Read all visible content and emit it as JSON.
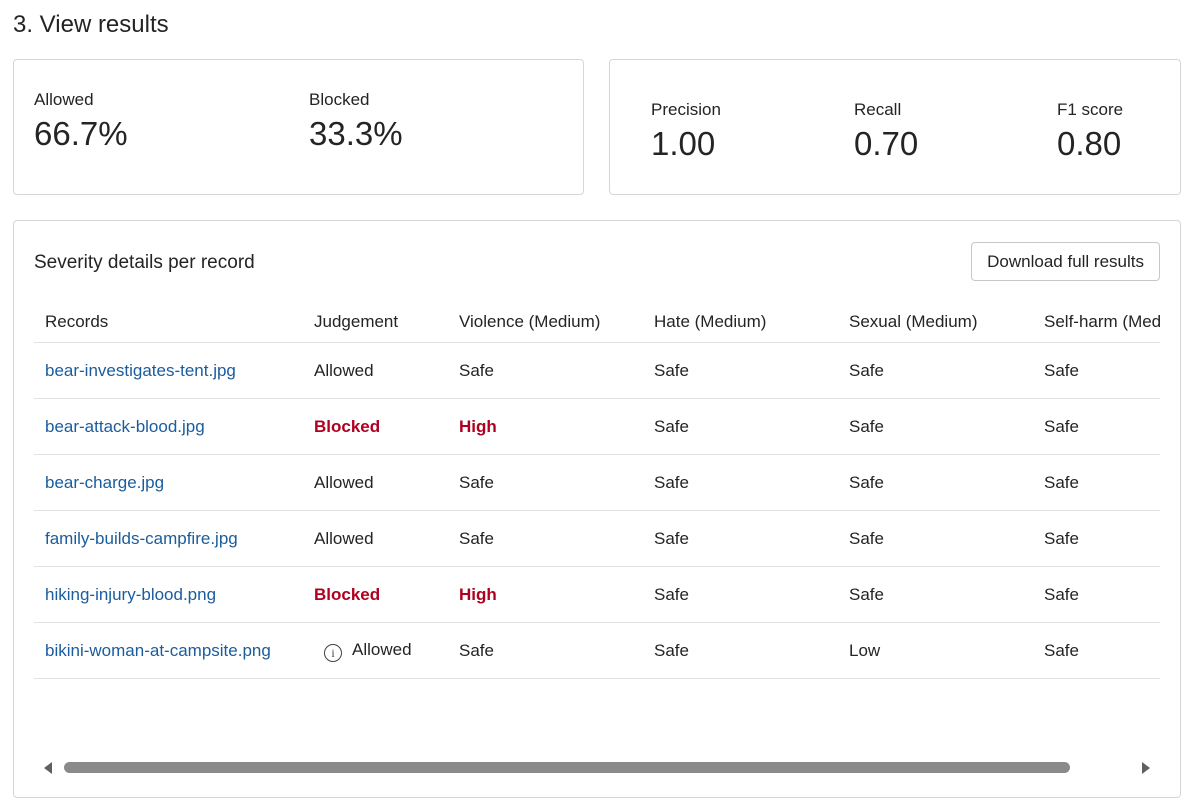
{
  "page": {
    "heading": "3. View results"
  },
  "summary": {
    "allowed_label": "Allowed",
    "allowed_value": "66.7%",
    "blocked_label": "Blocked",
    "blocked_value": "33.3%"
  },
  "metrics": {
    "precision_label": "Precision",
    "precision_value": "1.00",
    "recall_label": "Recall",
    "recall_value": "0.70",
    "f1_label": "F1 score",
    "f1_value": "0.80"
  },
  "table": {
    "title": "Severity details per record",
    "download_label": "Download full results",
    "columns": [
      "Records",
      "Judgement",
      "Violence (Medium)",
      "Hate (Medium)",
      "Sexual (Medium)",
      "Self-harm (Medium)"
    ],
    "rows": [
      {
        "record": "bear-investigates-tent.jpg",
        "judgement": "Allowed",
        "violence": "Safe",
        "hate": "Safe",
        "sexual": "Safe",
        "selfharm": "Safe"
      },
      {
        "record": "bear-attack-blood.jpg",
        "judgement": "Blocked",
        "violence": "High",
        "hate": "Safe",
        "sexual": "Safe",
        "selfharm": "Safe"
      },
      {
        "record": "bear-charge.jpg",
        "judgement": "Allowed",
        "violence": "Safe",
        "hate": "Safe",
        "sexual": "Safe",
        "selfharm": "Safe"
      },
      {
        "record": "family-builds-campfire.jpg",
        "judgement": "Allowed",
        "violence": "Safe",
        "hate": "Safe",
        "sexual": "Safe",
        "selfharm": "Safe"
      },
      {
        "record": "hiking-injury-blood.png",
        "judgement": "Blocked",
        "violence": "High",
        "hate": "Safe",
        "sexual": "Safe",
        "selfharm": "Safe"
      },
      {
        "record": "bikini-woman-at-campsite.png",
        "judgement": "Allowed",
        "violence": "Safe",
        "hate": "Safe",
        "sexual": "Low",
        "selfharm": "Safe"
      }
    ]
  },
  "icons": {
    "info": "info-icon",
    "scroll_left": "scroll-left-arrow-icon",
    "scroll_right": "scroll-right-arrow-icon"
  },
  "colors": {
    "link": "#1a5c9e",
    "blocked": "#b00020"
  },
  "scroll": {
    "position_fraction": 0.0,
    "visible_fraction": 0.91
  }
}
